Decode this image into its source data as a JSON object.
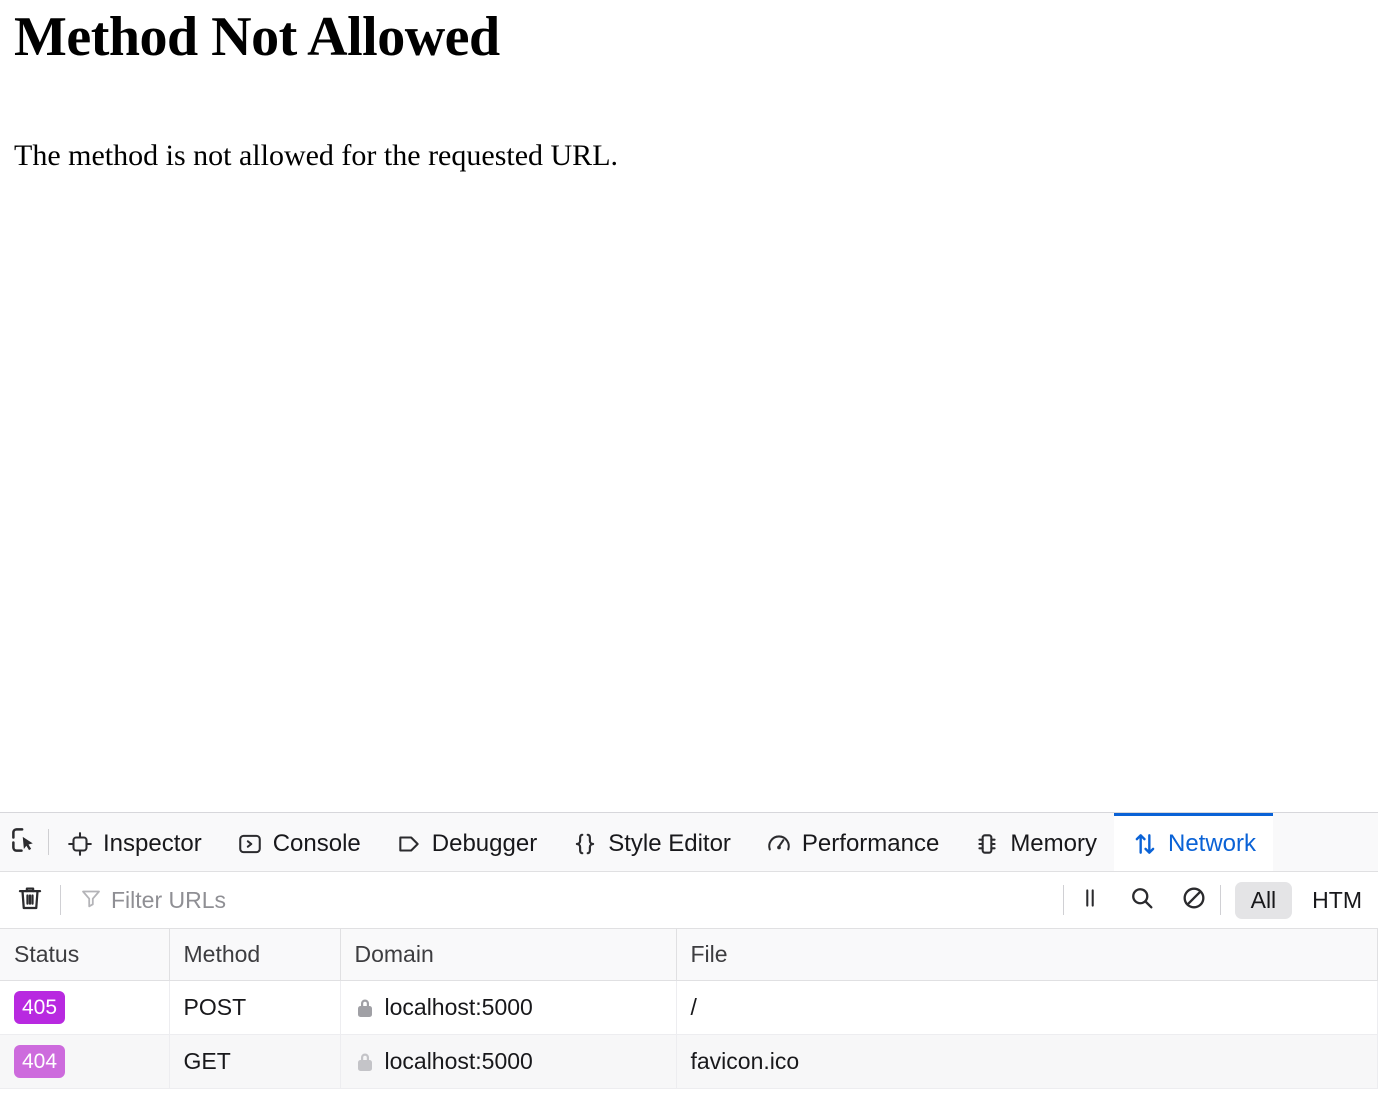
{
  "page": {
    "title": "Method Not Allowed",
    "message": "The method is not allowed for the requested URL."
  },
  "devtools": {
    "picker_icon": "element-picker-icon",
    "tabs": [
      {
        "id": "inspector",
        "label": "Inspector",
        "icon": "inspector-icon",
        "selected": false
      },
      {
        "id": "console",
        "label": "Console",
        "icon": "console-icon",
        "selected": false
      },
      {
        "id": "debugger",
        "label": "Debugger",
        "icon": "debugger-icon",
        "selected": false
      },
      {
        "id": "style-editor",
        "label": "Style Editor",
        "icon": "braces-icon",
        "selected": false
      },
      {
        "id": "performance",
        "label": "Performance",
        "icon": "gauge-icon",
        "selected": false
      },
      {
        "id": "memory",
        "label": "Memory",
        "icon": "memory-chip-icon",
        "selected": false
      },
      {
        "id": "network",
        "label": "Network",
        "icon": "up-down-arrow-icon",
        "selected": true
      }
    ],
    "accent_color": "#0a62d6",
    "toolbar": {
      "clear_icon": "trash-icon",
      "filter_icon": "funnel-icon",
      "filter_placeholder": "Filter URLs",
      "filter_value": "",
      "pause_icon": "pause-icon",
      "search_icon": "search-icon",
      "block_icon": "block-icon",
      "type_filters": [
        {
          "label": "All",
          "selected": true
        },
        {
          "label": "HTM",
          "selected": false
        }
      ]
    },
    "network": {
      "columns": [
        "Status",
        "Method",
        "Domain",
        "File"
      ],
      "rows": [
        {
          "status": "405",
          "method": "POST",
          "domain": "localhost:5000",
          "file": "/",
          "secure_icon": "lock-icon",
          "dimmed": false,
          "status_color": "#b829e0"
        },
        {
          "status": "404",
          "method": "GET",
          "domain": "localhost:5000",
          "file": "favicon.ico",
          "secure_icon": "lock-icon",
          "dimmed": true,
          "status_color": "#cd6bdd"
        }
      ]
    }
  }
}
